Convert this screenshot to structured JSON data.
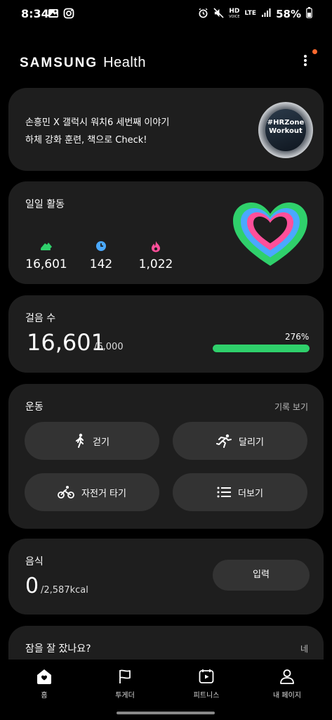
{
  "status_bar": {
    "time": "8:34",
    "hd_label": "HD",
    "voice_label": "VOICE",
    "lte_label": "LTE",
    "battery": "58%"
  },
  "header": {
    "brand_samsung": "SAMSUNG",
    "brand_health": "Health"
  },
  "promo": {
    "line1": "손흥민 X 갤럭시 워치6 세번째 이야기",
    "line2": "하체 강화 훈련, 책으로 Check!",
    "watch_text": "#HRZone Workout"
  },
  "daily_activity": {
    "title": "일일 활동",
    "metrics": [
      {
        "value": "16,601",
        "icon": "shoe-icon",
        "color": "#2fd06b"
      },
      {
        "value": "142",
        "icon": "clock-icon",
        "color": "#4aa8ff"
      },
      {
        "value": "1,022",
        "icon": "flame-icon",
        "color": "#ff4f9a"
      }
    ]
  },
  "steps": {
    "title": "걸음 수",
    "value": "16,601",
    "goal": "/6,000",
    "percent_label": "276%",
    "progress_fraction": 1.0
  },
  "exercise": {
    "title": "운동",
    "history_link": "기록 보기",
    "buttons": [
      {
        "label": "걷기",
        "icon": "walking-icon"
      },
      {
        "label": "달리기",
        "icon": "running-icon"
      },
      {
        "label": "자전거 타기",
        "icon": "cycling-icon"
      },
      {
        "label": "더보기",
        "icon": "list-icon"
      }
    ]
  },
  "food": {
    "title": "음식",
    "value": "0",
    "goal": "/2,587kcal",
    "input_button": "입력"
  },
  "sleep": {
    "title": "잠을 잘 잤나요?",
    "answer": "네"
  },
  "bottom_nav": [
    {
      "label": "홈",
      "icon": "home-icon",
      "active": true
    },
    {
      "label": "투게더",
      "icon": "flag-icon",
      "active": false
    },
    {
      "label": "피트니스",
      "icon": "play-calendar-icon",
      "active": false
    },
    {
      "label": "내 페이지",
      "icon": "person-icon",
      "active": false
    }
  ],
  "colors": {
    "background": "#000000",
    "card": "#1e1e1e",
    "button": "#333333",
    "accent_green": "#2fd06b",
    "accent_blue": "#4aa8ff",
    "accent_pink": "#ff4f9a",
    "notification": "#ff6a2f"
  }
}
